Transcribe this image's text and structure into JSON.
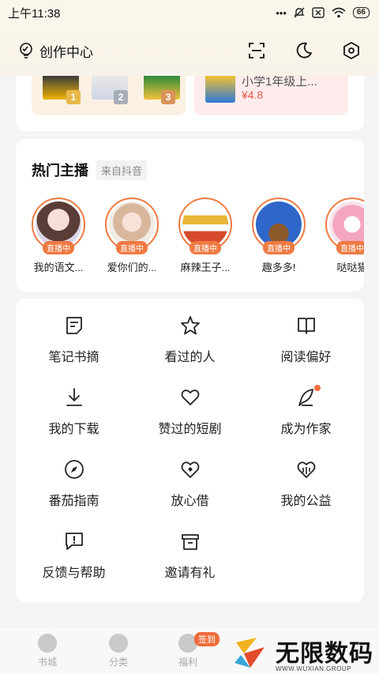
{
  "status": {
    "time": "上午11:38",
    "battery": "66"
  },
  "header": {
    "title": "创作中心"
  },
  "promo": {
    "ranks": [
      "1",
      "2",
      "3"
    ],
    "right_title": "小学1年级上...",
    "right_price": "¥4.8"
  },
  "hosts": {
    "title": "热门主播",
    "source": "来自抖音",
    "live_label": "直播中",
    "items": [
      {
        "name": "我的语文..."
      },
      {
        "name": "爱你们的..."
      },
      {
        "name": "麻辣王子..."
      },
      {
        "name": "趣多多!"
      },
      {
        "name": "哒哒猫"
      }
    ]
  },
  "menu": {
    "items": [
      {
        "label": "笔记书摘",
        "icon": "note-icon"
      },
      {
        "label": "看过的人",
        "icon": "star-icon"
      },
      {
        "label": "阅读偏好",
        "icon": "book-icon"
      },
      {
        "label": "我的下载",
        "icon": "download-icon"
      },
      {
        "label": "赞过的短剧",
        "icon": "heart-icon"
      },
      {
        "label": "成为作家",
        "icon": "pen-icon"
      },
      {
        "label": "番茄指南",
        "icon": "compass-icon"
      },
      {
        "label": "放心借",
        "icon": "heart-shield-icon"
      },
      {
        "label": "我的公益",
        "icon": "charity-heart-icon"
      },
      {
        "label": "反馈与帮助",
        "icon": "feedback-icon"
      },
      {
        "label": "邀请有礼",
        "icon": "gift-icon"
      }
    ]
  },
  "bottom_nav": {
    "items": [
      {
        "label": "书城"
      },
      {
        "label": "分类"
      },
      {
        "label": "福利"
      }
    ],
    "badge": "签到"
  },
  "watermark": {
    "title": "无限数码",
    "subtitle": "WWW.WUXIAN.GROUP"
  }
}
